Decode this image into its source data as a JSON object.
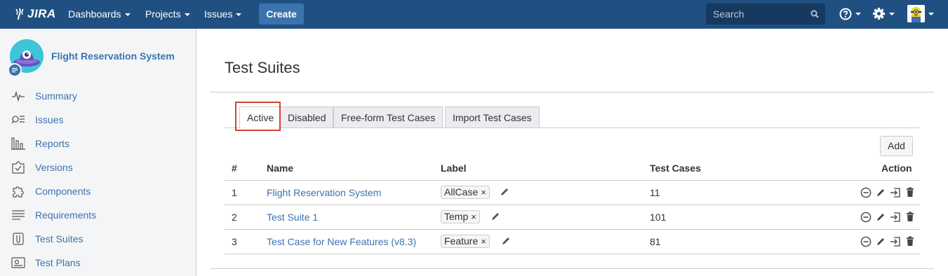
{
  "topbar": {
    "logo_text": "JIRA",
    "nav": [
      "Dashboards",
      "Projects",
      "Issues"
    ],
    "create_label": "Create",
    "search_placeholder": "Search"
  },
  "sidebar": {
    "project_name": "Flight Reservation System",
    "items": [
      {
        "label": "Summary",
        "icon": "pulse-icon"
      },
      {
        "label": "Issues",
        "icon": "issues-search-icon"
      },
      {
        "label": "Reports",
        "icon": "reports-icon"
      },
      {
        "label": "Versions",
        "icon": "versions-icon"
      },
      {
        "label": "Components",
        "icon": "puzzle-icon"
      },
      {
        "label": "Requirements",
        "icon": "requirements-icon"
      },
      {
        "label": "Test Suites",
        "icon": "test-suites-icon"
      },
      {
        "label": "Test Plans",
        "icon": "test-plans-icon"
      }
    ]
  },
  "main": {
    "title": "Test Suites",
    "tabs": [
      "Active",
      "Disabled",
      "Free-form Test Cases",
      "Import Test Cases"
    ],
    "add_label": "Add",
    "columns": [
      "#",
      "Name",
      "Label",
      "Test Cases",
      "Action"
    ],
    "rows": [
      {
        "num": "1",
        "name": "Flight Reservation System",
        "label": "AllCase",
        "test_cases": "11"
      },
      {
        "num": "2",
        "name": "Test Suite 1",
        "label": "Temp",
        "test_cases": "101"
      },
      {
        "num": "3",
        "name": "Test Case for New Features (v8.3)",
        "label": "Feature",
        "test_cases": "81"
      }
    ],
    "remove_glyph": "×"
  },
  "colors": {
    "topbar": "#205081",
    "create": "#3b73af",
    "link": "#3b73af",
    "highlight": "#d04437",
    "sidebar_bg": "#f4f5f7"
  }
}
